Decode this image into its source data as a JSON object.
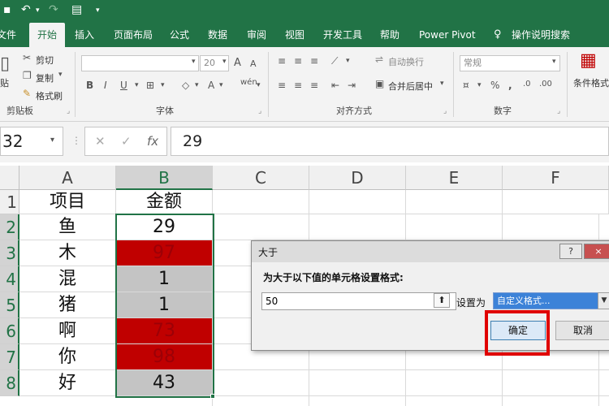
{
  "quick_access": {
    "save_icon": "save-icon",
    "undo_icon": "undo-icon",
    "redo_icon": "redo-icon",
    "form_icon": "form-icon",
    "customize_icon": "chevron-down-icon"
  },
  "tabs": [
    {
      "label": "文件"
    },
    {
      "label": "开始"
    },
    {
      "label": "插入"
    },
    {
      "label": "页面布局"
    },
    {
      "label": "公式"
    },
    {
      "label": "数据"
    },
    {
      "label": "审阅"
    },
    {
      "label": "视图"
    },
    {
      "label": "开发工具"
    },
    {
      "label": "帮助"
    },
    {
      "label": "Power Pivot"
    },
    {
      "label": "操作说明搜索"
    }
  ],
  "ribbon": {
    "clipboard": {
      "paste": "贴",
      "cut": "剪切",
      "copy": "复制",
      "format_painter": "格式刷",
      "group": "剪贴板"
    },
    "font": {
      "size": "20",
      "group": "字体"
    },
    "alignment": {
      "wrap": "自动换行",
      "merge": "合并后居中",
      "group": "对齐方式"
    },
    "number": {
      "format": "常规",
      "group": "数字"
    },
    "styles": {
      "conditional": "条件格式"
    }
  },
  "formula_bar": {
    "name_box": "32",
    "value": "29"
  },
  "sheet": {
    "columns": [
      "A",
      "B",
      "C",
      "D",
      "E",
      "F"
    ],
    "rows": [
      "1",
      "2",
      "3",
      "4",
      "5",
      "6",
      "7",
      "8"
    ],
    "header": {
      "a": "项目",
      "b": "金额"
    },
    "data": [
      {
        "item": "鱼",
        "amount": "29",
        "highlight": "none"
      },
      {
        "item": "木",
        "amount": "97",
        "highlight": "red"
      },
      {
        "item": "混",
        "amount": "1",
        "highlight": "gray"
      },
      {
        "item": "猪",
        "amount": "1",
        "highlight": "gray"
      },
      {
        "item": "啊",
        "amount": "73",
        "highlight": "red"
      },
      {
        "item": "你",
        "amount": "98",
        "highlight": "red"
      },
      {
        "item": "好",
        "amount": "43",
        "highlight": "gray"
      }
    ]
  },
  "dialog": {
    "title": "大于",
    "help_label": "?",
    "close_label": "×",
    "prompt": "为大于以下值的单元格设置格式:",
    "value": "50",
    "set_as_label": "设置为",
    "format_option": "自定义格式...",
    "ok_label": "确定",
    "cancel_label": "取消"
  },
  "colors": {
    "excel_green": "#217346",
    "red_fill": "#c00000",
    "gray_fill": "#c4c4c4",
    "highlight_box": "#e00000"
  }
}
